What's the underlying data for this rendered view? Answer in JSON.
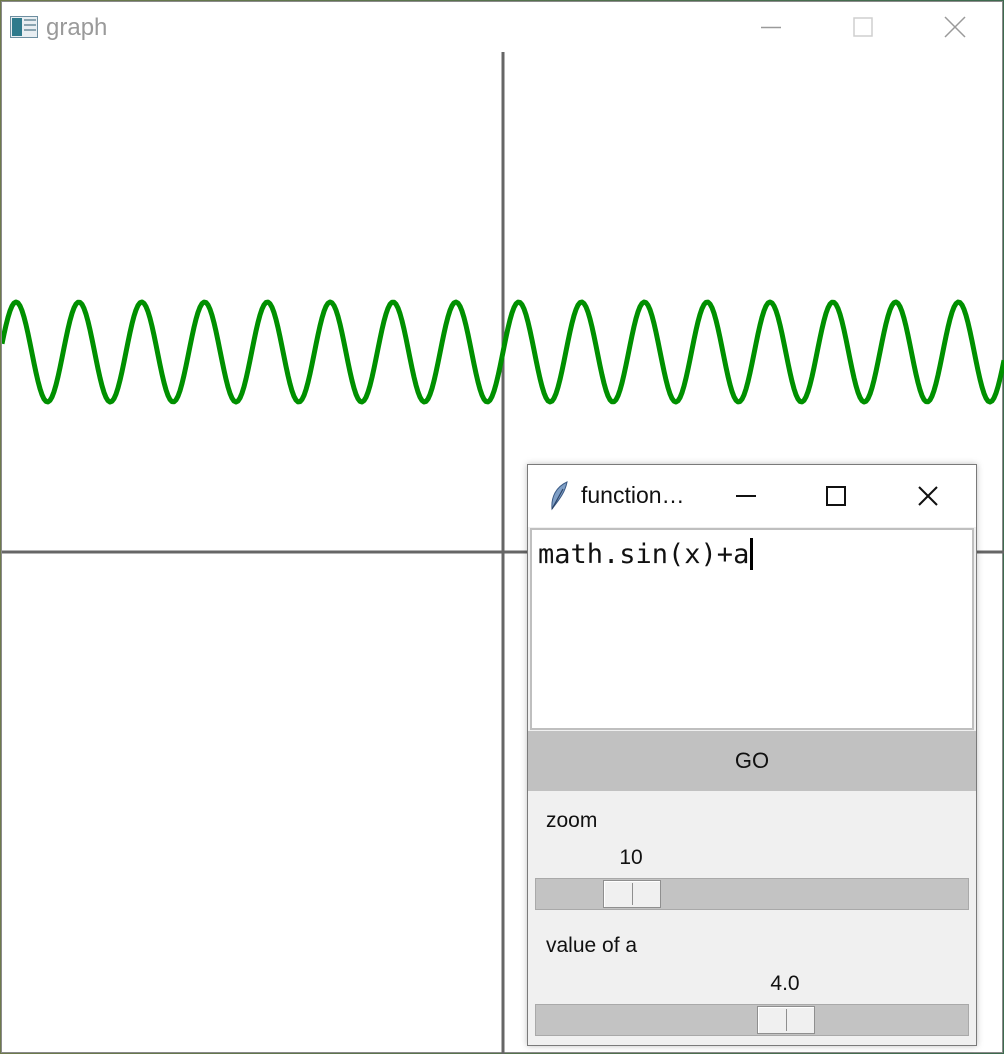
{
  "graph_window": {
    "title": "graph",
    "icons": {
      "app": "app-window-icon",
      "minimize": "minimize-icon",
      "maximize": "maximize-icon",
      "close": "close-icon"
    }
  },
  "plot": {
    "function": "math.sin(x)+a",
    "a": 4.0,
    "zoom": 10,
    "curve_color": "#009000",
    "axis_color": "#666666"
  },
  "function_window": {
    "title": "function…",
    "icons": {
      "app": "feather-icon",
      "minimize": "minimize-icon",
      "maximize": "maximize-icon",
      "close": "close-icon"
    },
    "expression": "math.sin(x)+a",
    "go_label": "GO",
    "zoom": {
      "label": "zoom",
      "value": "10",
      "min": 1,
      "max": 50,
      "fraction": 0.18
    },
    "a": {
      "label": "value of a",
      "value": "4.0",
      "min": -10,
      "max": 10,
      "fraction": 0.59
    }
  }
}
